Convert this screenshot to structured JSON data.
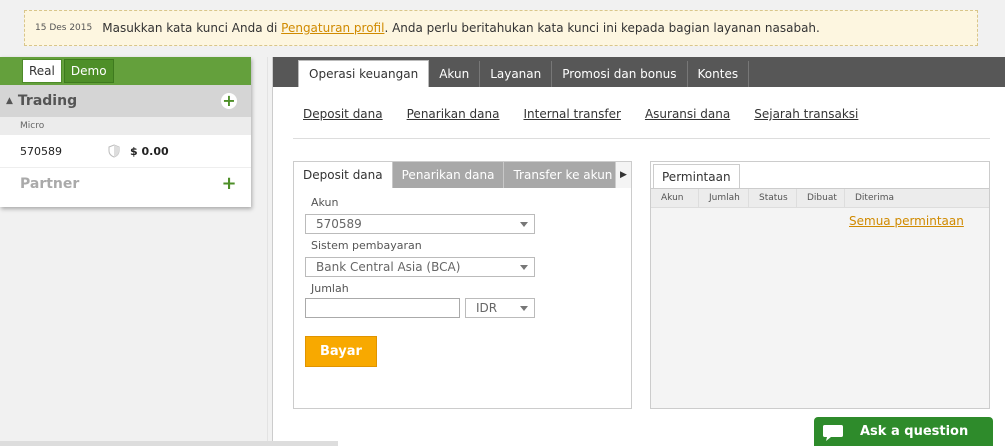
{
  "notice": {
    "date": "15 Des 2015",
    "message_before": "Masukkan kata kunci Anda di ",
    "link": "Pengaturan profil",
    "message_after": ". Anda perlu beritahukan kata kunci ini kepada bagian layanan nasabah."
  },
  "account_panel": {
    "modes": [
      "Real",
      "Demo"
    ],
    "trading_title": "Trading",
    "account_type": "Micro",
    "account_number": "570589",
    "balance": "$ 0.00",
    "partner_title": "Partner"
  },
  "top_tabs": [
    "Operasi keuangan",
    "Akun",
    "Layanan",
    "Promosi dan bonus",
    "Kontes"
  ],
  "subnav": [
    "Deposit dana",
    "Penarikan dana",
    "Internal transfer",
    "Asuransi dana",
    "Sejarah transaksi"
  ],
  "deposit": {
    "tabs": [
      "Deposit dana",
      "Penarikan dana",
      "Transfer ke akun lain"
    ],
    "account_label": "Akun",
    "account_value": "570589",
    "payment_label": "Sistem pembayaran",
    "payment_value": "Bank Central Asia (BCA)",
    "amount_label": "Jumlah",
    "amount_value": "",
    "currency": "IDR",
    "pay_button": "Bayar"
  },
  "requests": {
    "tab": "Permintaan",
    "columns": [
      "Akun",
      "Jumlah",
      "Status",
      "Dibuat",
      "Diterima"
    ],
    "all_link": "Semua permintaan"
  },
  "ask": {
    "label": "Ask a question"
  },
  "colors": {
    "green": "#64a03c",
    "dark_tab_bar": "#575757",
    "orange": "#f8a900",
    "link_orange": "#d08a00"
  }
}
